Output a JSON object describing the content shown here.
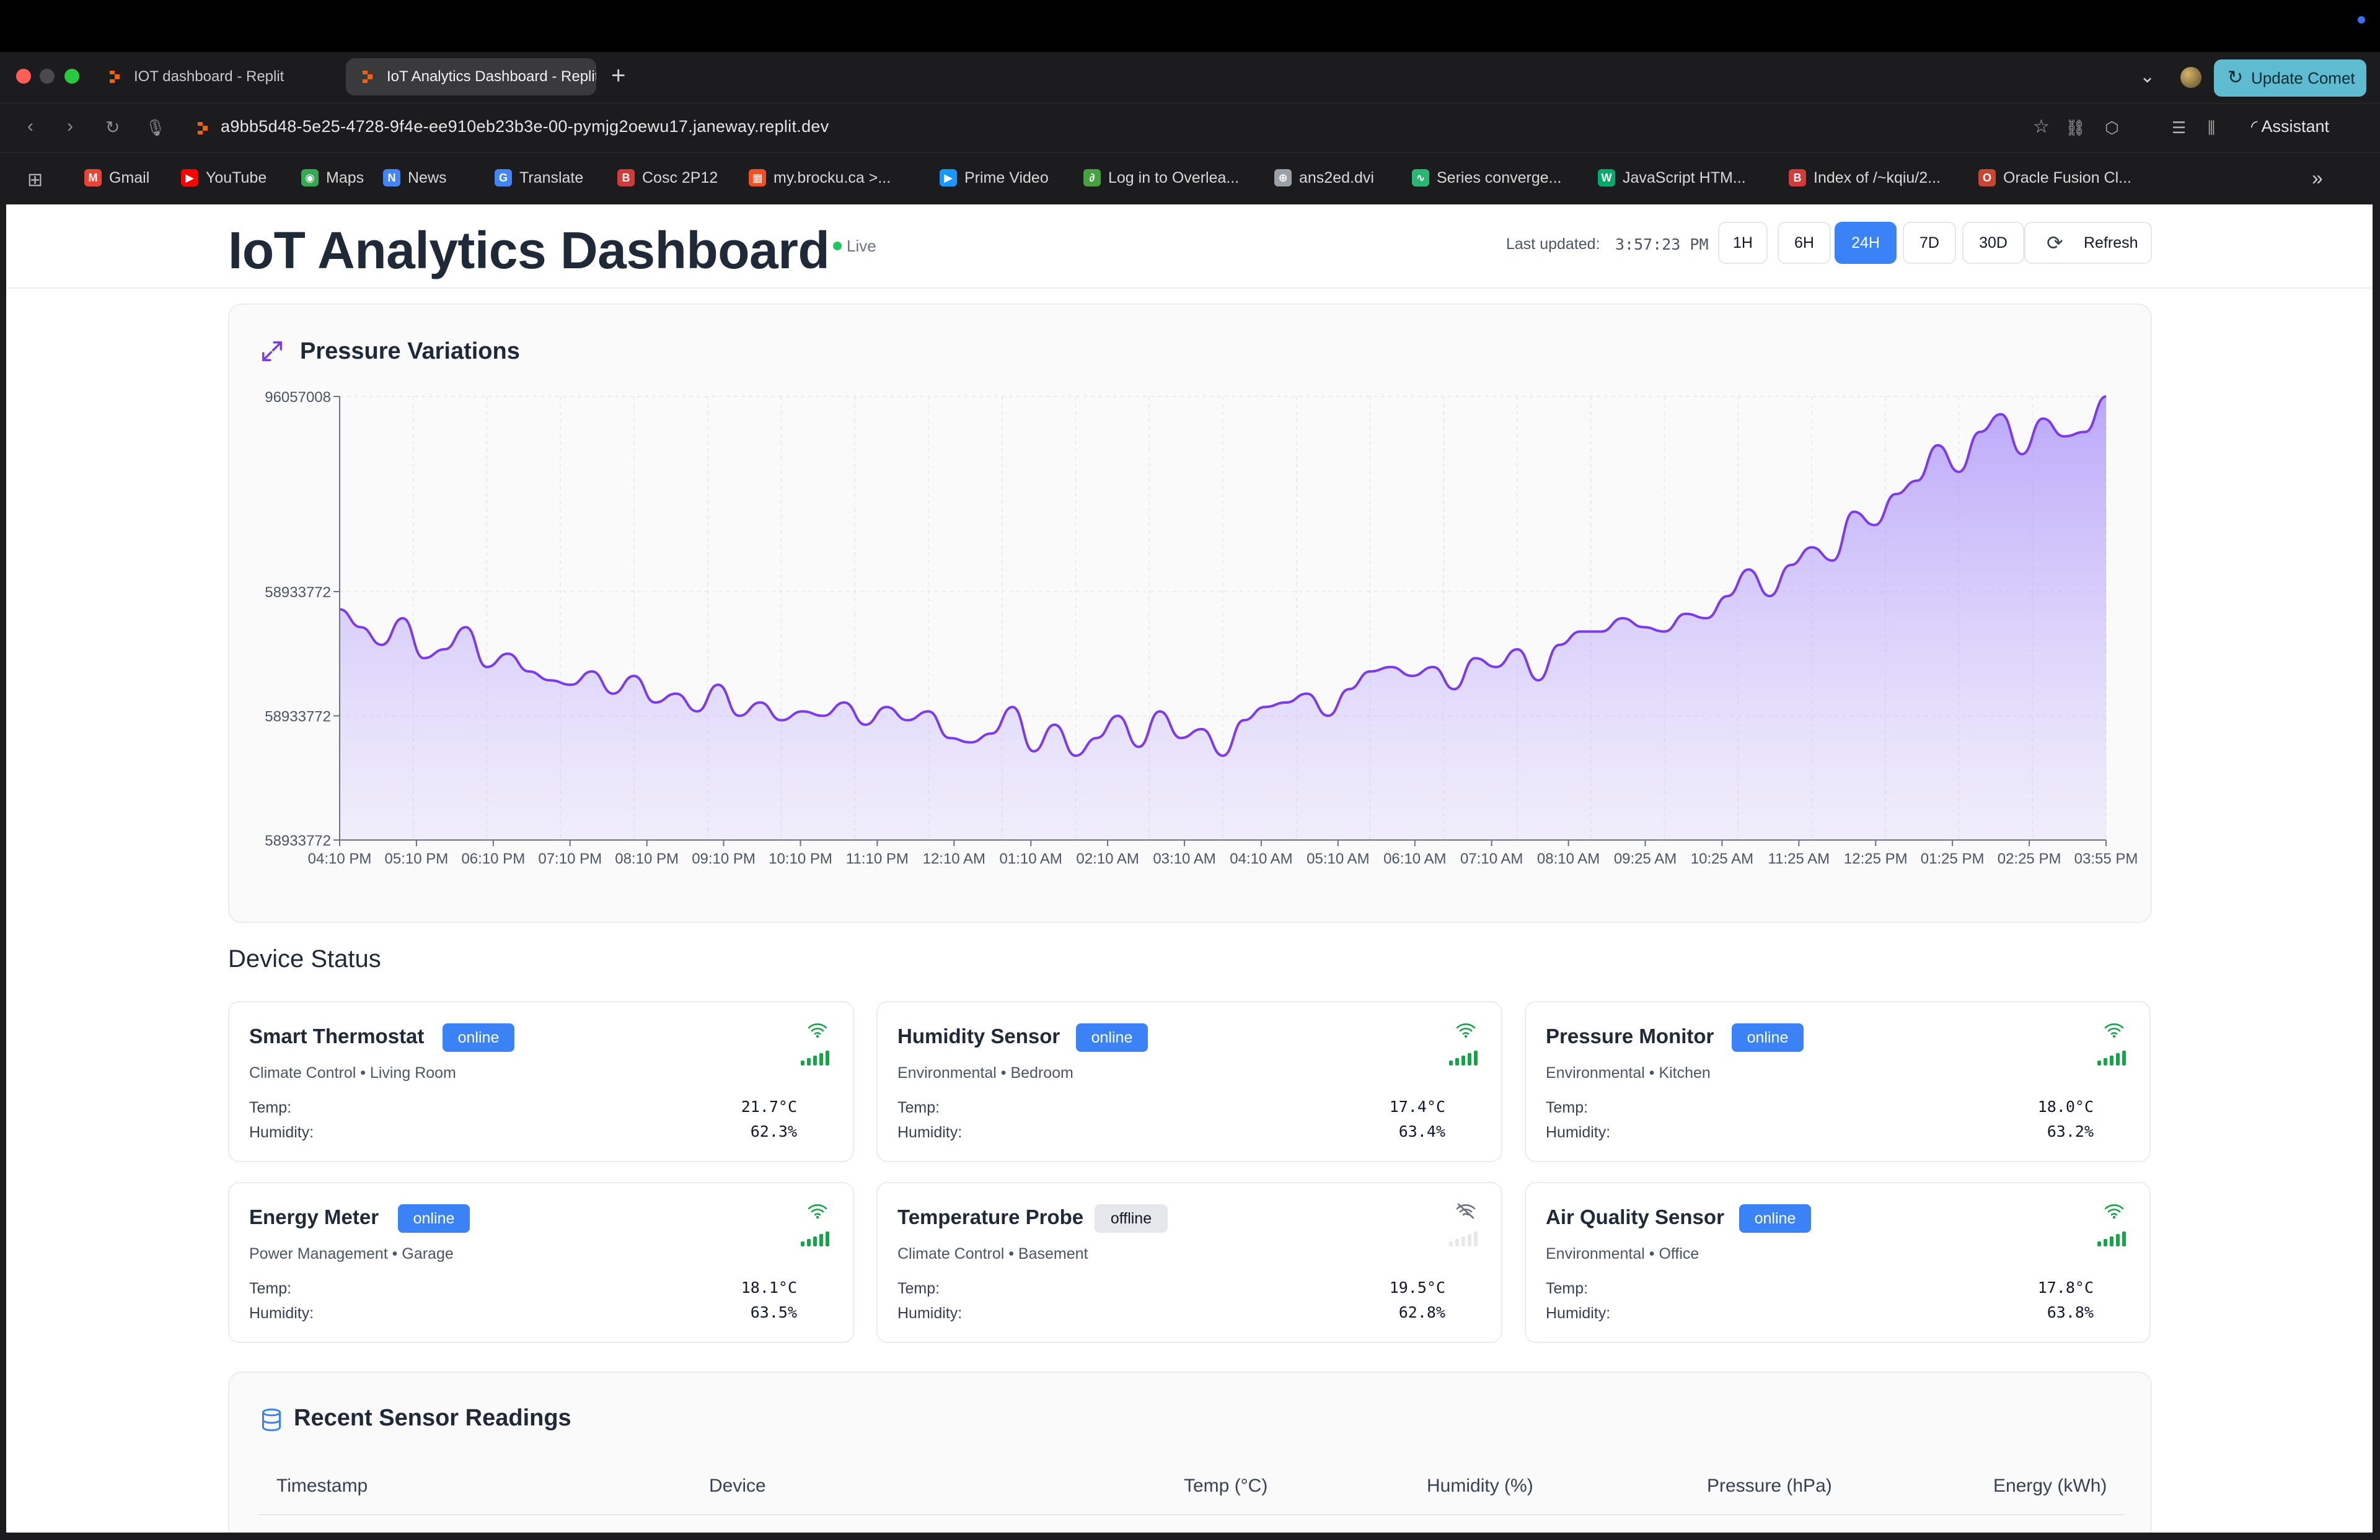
{
  "browser": {
    "tabs": [
      {
        "title": "IOT dashboard - Replit"
      },
      {
        "title": "IoT Analytics Dashboard - Replit"
      }
    ],
    "update_button": "Update Comet",
    "url": "a9bb5d48-5e25-4728-9f4e-ee910eb23b3e-00-pymjg2oewu17.janeway.replit.dev",
    "assistant_label": "Assistant",
    "bookmarks": [
      {
        "label": "Gmail",
        "icon": "gmail-icon",
        "color": "#ea4335"
      },
      {
        "label": "YouTube",
        "icon": "youtube-icon",
        "color": "#ff0000"
      },
      {
        "label": "Maps",
        "icon": "maps-icon",
        "color": "#34a853"
      },
      {
        "label": "News",
        "icon": "news-icon",
        "color": "#4285f4"
      },
      {
        "label": "Translate",
        "icon": "translate-icon",
        "color": "#4285f4"
      },
      {
        "label": "Cosc 2P12",
        "icon": "brock-icon",
        "color": "#d23b3b"
      },
      {
        "label": "my.brocku.ca >...",
        "icon": "microsoft-icon",
        "color": "#f25022"
      },
      {
        "label": "Prime Video",
        "icon": "prime-video-icon",
        "color": "#1a98ff"
      },
      {
        "label": "Log in to Overlea...",
        "icon": "overleaf-icon",
        "color": "#47a141"
      },
      {
        "label": "ans2ed.dvi",
        "icon": "globe-icon",
        "color": "#9aa0a6"
      },
      {
        "label": "Series converge...",
        "icon": "series-icon",
        "color": "#2bb673"
      },
      {
        "label": "JavaScript HTM...",
        "icon": "w3schools-icon",
        "color": "#04aa6d"
      },
      {
        "label": "Index of /~kqiu/2...",
        "icon": "brock-icon",
        "color": "#d23b3b"
      },
      {
        "label": "Oracle Fusion Cl...",
        "icon": "oracle-icon",
        "color": "#c74634"
      }
    ]
  },
  "header": {
    "title": "IoT Analytics Dashboard",
    "live_label": "Live",
    "last_updated_label": "Last updated:",
    "last_updated_time": "3:57:23 PM",
    "ranges": [
      "1H",
      "6H",
      "24H",
      "7D",
      "30D"
    ],
    "active_range": "24H",
    "refresh_label": "Refresh"
  },
  "chart_card": {
    "title": "Pressure Variations",
    "icon": "expand-arrows-icon"
  },
  "chart_data": {
    "type": "area",
    "title": "Pressure Variations",
    "color": "#7c3aed",
    "y_tick_labels": [
      "96057008",
      "58933772",
      "58933772",
      "58933772"
    ],
    "x_tick_labels": [
      "04:10 PM",
      "05:10 PM",
      "06:10 PM",
      "07:10 PM",
      "08:10 PM",
      "09:10 PM",
      "10:10 PM",
      "11:10 PM",
      "12:10 AM",
      "01:10 AM",
      "02:10 AM",
      "03:10 AM",
      "04:10 AM",
      "05:10 AM",
      "06:10 AM",
      "07:10 AM",
      "08:10 AM",
      "09:25 AM",
      "10:25 AM",
      "11:25 AM",
      "12:25 PM",
      "01:25 PM",
      "02:25 PM",
      "03:55 PM"
    ],
    "values": [
      0.52,
      0.48,
      0.44,
      0.5,
      0.41,
      0.43,
      0.48,
      0.39,
      0.42,
      0.38,
      0.36,
      0.35,
      0.38,
      0.33,
      0.37,
      0.31,
      0.33,
      0.29,
      0.35,
      0.28,
      0.31,
      0.27,
      0.29,
      0.28,
      0.31,
      0.26,
      0.3,
      0.27,
      0.29,
      0.23,
      0.22,
      0.24,
      0.3,
      0.2,
      0.26,
      0.19,
      0.23,
      0.28,
      0.21,
      0.29,
      0.23,
      0.25,
      0.19,
      0.27,
      0.3,
      0.31,
      0.33,
      0.28,
      0.34,
      0.38,
      0.39,
      0.37,
      0.39,
      0.34,
      0.41,
      0.39,
      0.43,
      0.36,
      0.44,
      0.47,
      0.47,
      0.5,
      0.48,
      0.47,
      0.51,
      0.5,
      0.55,
      0.61,
      0.55,
      0.62,
      0.66,
      0.63,
      0.74,
      0.71,
      0.78,
      0.81,
      0.89,
      0.83,
      0.92,
      0.96,
      0.87,
      0.95,
      0.91,
      0.92,
      1.0
    ],
    "grid": true
  },
  "device_section_title": "Device Status",
  "devices": [
    {
      "name": "Smart Thermostat",
      "status": "online",
      "category": "Climate Control • Living Room",
      "temp_label": "Temp:",
      "temp": "21.7°C",
      "humidity_label": "Humidity:",
      "humidity": "62.3%",
      "signal": "wifi-icon"
    },
    {
      "name": "Humidity Sensor",
      "status": "online",
      "category": "Environmental • Bedroom",
      "temp_label": "Temp:",
      "temp": "17.4°C",
      "humidity_label": "Humidity:",
      "humidity": "63.4%",
      "signal": "wifi-icon"
    },
    {
      "name": "Pressure Monitor",
      "status": "online",
      "category": "Environmental • Kitchen",
      "temp_label": "Temp:",
      "temp": "18.0°C",
      "humidity_label": "Humidity:",
      "humidity": "63.2%",
      "signal": "wifi-icon"
    },
    {
      "name": "Energy Meter",
      "status": "online",
      "category": "Power Management • Garage",
      "temp_label": "Temp:",
      "temp": "18.1°C",
      "humidity_label": "Humidity:",
      "humidity": "63.5%",
      "signal": "wifi-icon"
    },
    {
      "name": "Temperature Probe",
      "status": "offline",
      "category": "Climate Control • Basement",
      "temp_label": "Temp:",
      "temp": "19.5°C",
      "humidity_label": "Humidity:",
      "humidity": "62.8%",
      "signal": "wifi-off-icon"
    },
    {
      "name": "Air Quality Sensor",
      "status": "online",
      "category": "Environmental • Office",
      "temp_label": "Temp:",
      "temp": "17.8°C",
      "humidity_label": "Humidity:",
      "humidity": "63.8%",
      "signal": "wifi-icon"
    }
  ],
  "readings": {
    "title": "Recent Sensor Readings",
    "icon": "database-icon",
    "columns": [
      "Timestamp",
      "Device",
      "Temp (°C)",
      "Humidity (%)",
      "Pressure (hPa)",
      "Energy (kWh)"
    ]
  }
}
